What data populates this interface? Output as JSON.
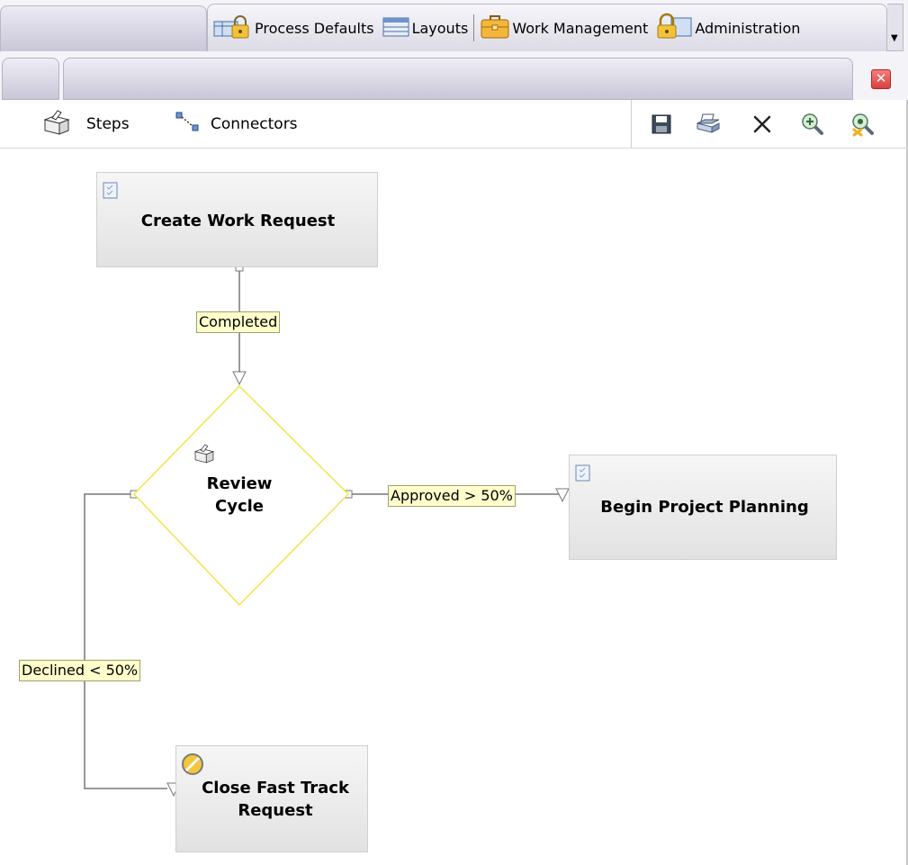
{
  "top_tabs": [
    {
      "label": "Process Defaults",
      "icon": "lock-folder-icon"
    },
    {
      "label": "Layouts",
      "icon": "layout-icon"
    },
    {
      "label": "Work Management",
      "icon": "briefcase-icon"
    },
    {
      "label": "Administration",
      "icon": "lock-icon"
    }
  ],
  "toolbar": {
    "steps_label": "Steps",
    "connectors_label": "Connectors",
    "actions": [
      "save-icon",
      "print-icon",
      "delete-icon",
      "zoom-in-icon",
      "zoom-reset-icon"
    ]
  },
  "colors": {
    "label_bg": "#ffffcc",
    "decision_stroke": "#f2e44a",
    "close_button": "#e05252"
  },
  "workflow": {
    "nodes": [
      {
        "id": "create",
        "title": "Create Work Request",
        "icon": "task-icon"
      },
      {
        "id": "review",
        "title_line1": "Review",
        "title_line2": "Cycle",
        "icon": "step-icon"
      },
      {
        "id": "begin",
        "title": "Begin Project Planning",
        "icon": "task-icon"
      },
      {
        "id": "close",
        "title_line1": "Close Fast Track",
        "title_line2": "Request",
        "icon": "blocked-icon"
      }
    ],
    "edges": [
      {
        "label": "Completed"
      },
      {
        "label": "Approved > 50%"
      },
      {
        "label": "Declined < 50%"
      }
    ]
  }
}
